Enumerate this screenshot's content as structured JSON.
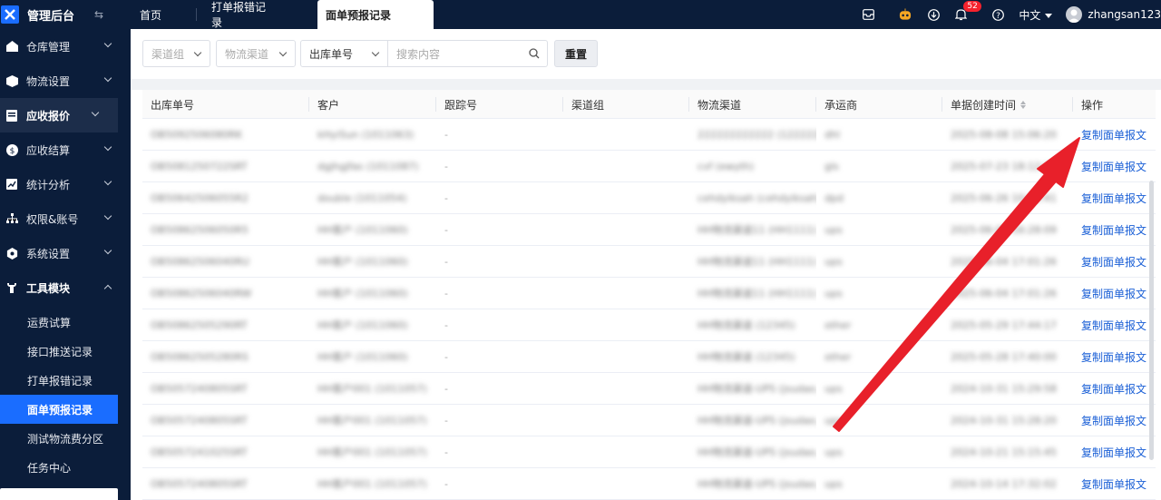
{
  "app": {
    "title": "管理后台"
  },
  "sidebar": {
    "items": [
      {
        "label": "仓库管理",
        "icon": "warehouse-icon"
      },
      {
        "label": "物流设置",
        "icon": "cube-icon"
      },
      {
        "label": "应收报价",
        "icon": "document-icon"
      },
      {
        "label": "应收结算",
        "icon": "dollar-icon"
      },
      {
        "label": "统计分析",
        "icon": "chart-icon"
      },
      {
        "label": "权限&账号",
        "icon": "org-icon"
      },
      {
        "label": "系统设置",
        "icon": "gear-icon"
      },
      {
        "label": "工具模块",
        "icon": "wrench-icon"
      }
    ],
    "subitems": [
      "运费试算",
      "接口推送记录",
      "打单报错记录",
      "面单预报记录",
      "测试物流费分区",
      "任务中心"
    ],
    "active_sub": "面单预报记录"
  },
  "header": {
    "tabs": [
      "首页",
      "打单报错记录",
      "面单预报记录"
    ],
    "notification_count": "52",
    "language": "中文",
    "username": "zhangsan123"
  },
  "filters": {
    "channel_group_placeholder": "渠道组",
    "logistics_channel_placeholder": "物流渠道",
    "search_type": "出库单号",
    "search_placeholder": "搜索内容",
    "reset_label": "重置"
  },
  "table": {
    "columns": [
      "出库单号",
      "客户",
      "跟踪号",
      "渠道组",
      "物流渠道",
      "承运商",
      "单据创建时间",
      "操作"
    ],
    "action_label": "复制面单报文",
    "rows": [
      {
        "order": "OB5092506080RK",
        "customer": "kHyiSun (1011063)",
        "tracking": "-",
        "group": "",
        "channel": "222222222222 (122222)",
        "carrier": "dhl",
        "time": "2025-08-08 15:06:20"
      },
      {
        "order": "OB5081250722SRT",
        "customer": "dgjhgjfas (1011087)",
        "tracking": "-",
        "group": "",
        "channel": "cvf (ewyth)",
        "carrier": "gls",
        "time": "2025-07-23 18:12:07"
      },
      {
        "order": "OB50642506055R2",
        "customer": "double (1011054)",
        "tracking": "-",
        "group": "",
        "channel": "cehdyiksah (cehdyiksah)",
        "carrier": "dpd",
        "time": "2025-06-26 10:03:41"
      },
      {
        "order": "OB50862506050R5",
        "customer": "HH客户 (1011060)",
        "tracking": "-",
        "group": "",
        "channel": "HH物流渠道11 (HH1111)",
        "carrier": "ups",
        "time": "2025-06-05 16:28:09"
      },
      {
        "order": "OB50862506040RU",
        "customer": "HH客户 (1011060)",
        "tracking": "-",
        "group": "",
        "channel": "HH物流渠道11 (HH1111)",
        "carrier": "ups",
        "time": "2025-06-04 17:01:26"
      },
      {
        "order": "OB50862506040RW",
        "customer": "HH客户 (1011060)",
        "tracking": "-",
        "group": "",
        "channel": "HH物流渠道11 (HH1111)",
        "carrier": "ups",
        "time": "2025-06-04 17:01:26"
      },
      {
        "order": "OB50862505290RT",
        "customer": "HH客户 (1011060)",
        "tracking": "-",
        "group": "",
        "channel": "HH物流渠道 (12345)",
        "carrier": "other",
        "time": "2025-05-29 17:44:17"
      },
      {
        "order": "OB50862505280RS",
        "customer": "HH客户 (1011060)",
        "tracking": "-",
        "group": "",
        "channel": "HH物流渠道 (12345)",
        "carrier": "other",
        "time": "2025-05-28 17:40:00"
      },
      {
        "order": "OB5057240805SRT",
        "customer": "HH客户001 (1011057)",
        "tracking": "-",
        "group": "",
        "channel": "HH物流渠道-UPS (jsudao...",
        "carrier": "ups",
        "time": "2024-10-31 15:29:58"
      },
      {
        "order": "OB5057240805SRT",
        "customer": "HH客户001 (1011057)",
        "tracking": "-",
        "group": "",
        "channel": "HH物流渠道-UPS (jsudao...",
        "carrier": "ups",
        "time": "2024-10-31 15:28:20"
      },
      {
        "order": "OB5057241025SRT",
        "customer": "HH客户001 (1011057)",
        "tracking": "-",
        "group": "",
        "channel": "HH物流渠道-UPS (jsudao...",
        "carrier": "ups",
        "time": "2024-10-21 15:15:45"
      },
      {
        "order": "OB5057240805SRT",
        "customer": "HH客户001 (1011057)",
        "tracking": "-",
        "group": "",
        "channel": "HH物流渠道-UPS (jsudao...",
        "carrier": "ups",
        "time": "2024-10-14 17:32:02"
      }
    ]
  },
  "colors": {
    "sidebar_bg": "#0b1d3a",
    "accent": "#1a6dff",
    "link": "#1a5fd6",
    "arrow": "#e8202a",
    "badge": "#f5222d"
  }
}
